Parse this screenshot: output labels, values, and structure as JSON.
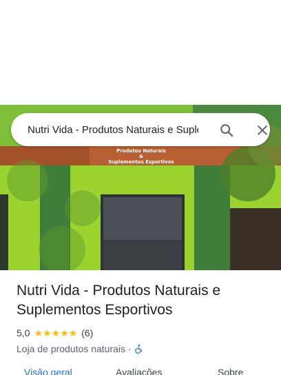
{
  "search": {
    "query": "Nutri Vida - Produtos Naturais e Suplementos Esportivos"
  },
  "hero": {
    "sign_line1": "Produtos Naturais",
    "sign_line2": "&",
    "sign_line3": "Suplementos Esportivos"
  },
  "place": {
    "name": "Nutri Vida - Produtos Naturais e Suplementos Esportivos",
    "rating": "5,0",
    "stars": "★★★★★",
    "review_count": "(6)",
    "category": "Loja de produtos naturais",
    "separator": "·"
  },
  "tabs": [
    {
      "label": "Visão geral"
    },
    {
      "label": "Avaliações"
    },
    {
      "label": "Sobre"
    }
  ],
  "colors": {
    "accent": "#1a73e8",
    "star": "#fbbc04",
    "wall_lime": "#8fd12a",
    "wall_green": "#3f7d3a"
  }
}
